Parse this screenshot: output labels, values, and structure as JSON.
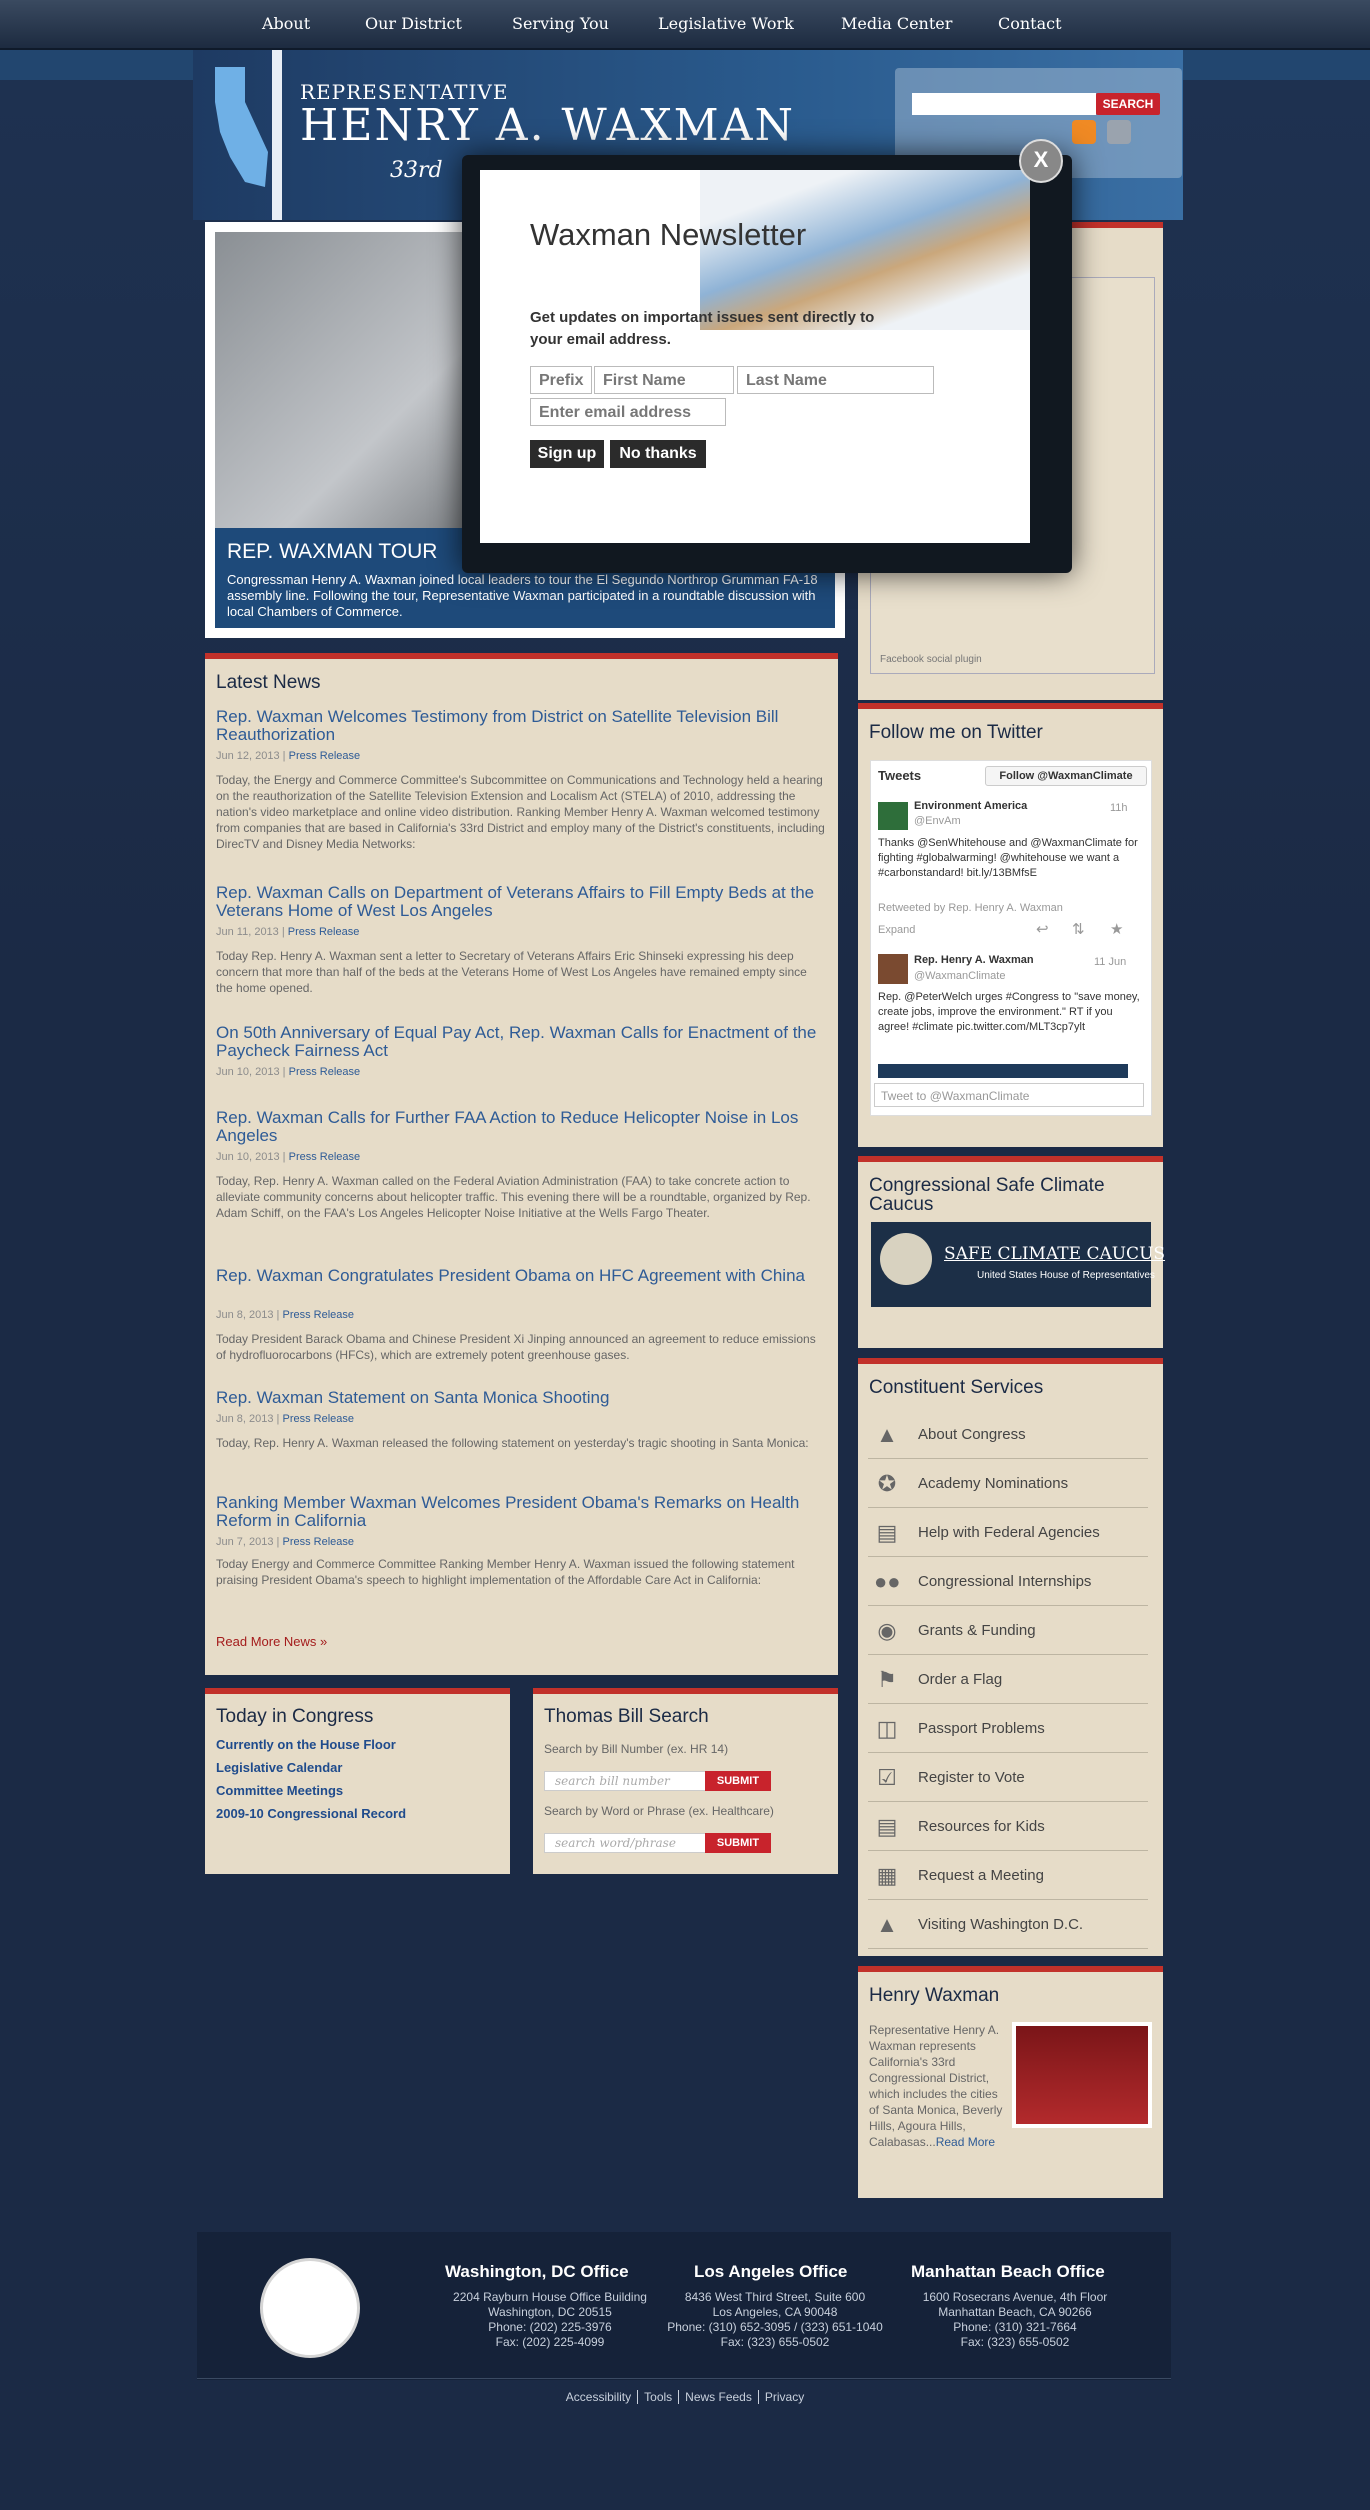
{
  "nav": [
    "About",
    "Our District",
    "Serving You",
    "Legislative Work",
    "Media Center",
    "Contact"
  ],
  "header": {
    "rep": "REPRESENTATIVE",
    "name": "HENRY A. WAXMAN",
    "district": "33rd",
    "search_button": "SEARCH"
  },
  "feature": {
    "title": "REP. WAXMAN TOUR",
    "text": "Congressman Henry A. Waxman joined local leaders to tour the El Segundo Northrop Grumman FA-18 assembly line. Following the tour, Representative Waxman participated in a roundtable discussion with local Chambers of Commerce."
  },
  "news": {
    "title": "Latest News",
    "items": [
      {
        "title": "Rep. Waxman Welcomes Testimony from District on Satellite Television Bill Reauthorization",
        "date": "Jun 12, 2013",
        "type": "Press Release",
        "body": "Today, the Energy and Commerce Committee's Subcommittee on Communications and Technology held a hearing on the reauthorization of the Satellite Television Extension and Localism Act (STELA) of 2010, addressing the nation's video marketplace and online video distribution. Ranking Member Henry A. Waxman welcomed testimony from companies that are based in California's 33rd District and employ many of the District's constituents, including DirecTV and Disney Media Networks:"
      },
      {
        "title": "Rep. Waxman Calls on Department of Veterans Affairs to Fill Empty Beds at the Veterans Home of West Los Angeles",
        "date": "Jun 11, 2013",
        "type": "Press Release",
        "body": "Today Rep. Henry A. Waxman sent a letter to Secretary of Veterans Affairs Eric Shinseki expressing his deep concern that more than half of the beds at the Veterans Home of West Los Angeles have remained empty since the home opened."
      },
      {
        "title": "On 50th Anniversary of Equal Pay Act, Rep. Waxman Calls for Enactment of the Paycheck Fairness Act",
        "date": "Jun 10, 2013",
        "type": "Press Release",
        "body": ""
      },
      {
        "title": "Rep. Waxman Calls for Further FAA Action to Reduce Helicopter Noise in Los Angeles",
        "date": "Jun 10, 2013",
        "type": "Press Release",
        "body": "Today, Rep. Henry A. Waxman called on the Federal Aviation Administration (FAA) to take concrete action to alleviate community concerns about helicopter traffic. This evening there will be a roundtable, organized by Rep. Adam Schiff, on the FAA's Los Angeles Helicopter Noise Initiative at the Wells Fargo Theater."
      },
      {
        "title": "Rep. Waxman Congratulates President Obama on HFC Agreement with China",
        "date": "Jun 8, 2013",
        "type": "Press Release",
        "body": "Today President Barack Obama and Chinese President Xi Jinping announced an agreement to reduce emissions of hydrofluorocarbons (HFCs), which are extremely potent greenhouse gases."
      },
      {
        "title": "Rep. Waxman Statement on Santa Monica Shooting",
        "date": "Jun 8, 2013",
        "type": "Press Release",
        "body": "Today, Rep. Henry A. Waxman released the following statement on yesterday's tragic shooting in Santa Monica:"
      },
      {
        "title": "Ranking Member Waxman Welcomes President Obama's Remarks on Health Reform in California",
        "date": "Jun 7, 2013",
        "type": "Press Release",
        "body": "Today Energy and Commerce Committee Ranking Member Henry A. Waxman issued the following statement praising President Obama's speech to highlight implementation of the Affordable Care Act in California:"
      }
    ],
    "read_more": "Read More News »"
  },
  "today": {
    "title": "Today in Congress",
    "links": [
      "Currently on the House Floor",
      "Legislative Calendar",
      "Committee Meetings",
      "2009-10 Congressional Record"
    ]
  },
  "thomas": {
    "title": "Thomas Bill Search",
    "label1": "Search by Bill Number (ex. HR 14)",
    "placeholder1": "search bill number",
    "label2": "Search by Word or Phrase (ex. Healthcare)",
    "placeholder2": "search word/phrase",
    "submit": "SUBMIT"
  },
  "facebook": {
    "plugin": "Facebook social plugin"
  },
  "twitter": {
    "title": "Follow me on Twitter",
    "tweets_label": "Tweets",
    "follow_button": "Follow @WaxmanClimate",
    "t1_name": "Environment America",
    "t1_handle": "@EnvAm",
    "t1_date": "11h",
    "t1_text": "Thanks @SenWhitehouse and @WaxmanClimate for fighting #globalwarming! @whitehouse we want a #carbonstandard! bit.ly/13BMfsE",
    "t1_rt": "Retweeted by Rep. Henry A. Waxman",
    "expand": "Expand",
    "t2_name": "Rep. Henry A. Waxman",
    "t2_handle": "@WaxmanClimate",
    "t2_date": "11 Jun",
    "t2_text": "Rep. @PeterWelch urges #Congress to \"save money, create jobs, improve the environment.\" RT if you agree! #climate pic.twitter.com/MLT3cp7ylt",
    "tweet_to": "Tweet to @WaxmanClimate"
  },
  "climate": {
    "title": "Congressional Safe Climate Caucus",
    "banner": "SAFE CLIMATE CAUCUS",
    "banner_sub": "United States House of Representatives"
  },
  "constituent": {
    "title": "Constituent Services",
    "items": [
      {
        "label": "About Congress",
        "icon": "capitol-icon"
      },
      {
        "label": "Academy Nominations",
        "icon": "star-badge-icon"
      },
      {
        "label": "Help with Federal Agencies",
        "icon": "building-icon"
      },
      {
        "label": "Congressional Internships",
        "icon": "people-icon"
      },
      {
        "label": "Grants & Funding",
        "icon": "money-bag-icon"
      },
      {
        "label": "Order a Flag",
        "icon": "flag-icon"
      },
      {
        "label": "Passport Problems",
        "icon": "passport-icon"
      },
      {
        "label": "Register to Vote",
        "icon": "checkbox-icon"
      },
      {
        "label": "Resources for Kids",
        "icon": "book-icon"
      },
      {
        "label": "Request a Meeting",
        "icon": "calendar-icon"
      },
      {
        "label": "Visiting Washington D.C.",
        "icon": "landmark-icon"
      }
    ]
  },
  "bio": {
    "title": "Henry Waxman",
    "text": "Representative Henry A. Waxman represents California's 33rd Congressional District, which includes the cities of Santa Monica, Beverly Hills, Agoura Hills, Calabasas...",
    "read_more": "Read More"
  },
  "footer": {
    "offices": [
      {
        "title": "Washington, DC Office",
        "lines": [
          "2204 Rayburn House Office Building",
          "Washington, DC 20515",
          "Phone: (202) 225-3976",
          "Fax: (202) 225-4099"
        ]
      },
      {
        "title": "Los Angeles Office",
        "lines": [
          "8436 West Third Street, Suite 600",
          "Los Angeles, CA 90048",
          "Phone: (310) 652-3095 / (323) 651-1040",
          "Fax: (323) 655-0502"
        ]
      },
      {
        "title": "Manhattan Beach Office",
        "lines": [
          "1600 Rosecrans Avenue, 4th Floor",
          "Manhattan Beach, CA 90266",
          "Phone: (310) 321-7664",
          "Fax: (323) 655-0502"
        ]
      }
    ],
    "links": [
      "Accessibility",
      "Tools",
      "News Feeds",
      "Privacy"
    ]
  },
  "modal": {
    "title": "Waxman Newsletter",
    "text": "Get updates on important issues sent directly to your email address.",
    "prefix_placeholder": "Prefix",
    "first_placeholder": "First Name",
    "last_placeholder": "Last Name",
    "email_placeholder": "Enter email address",
    "signup": "Sign up",
    "nothanks": "No thanks",
    "close": "X"
  }
}
